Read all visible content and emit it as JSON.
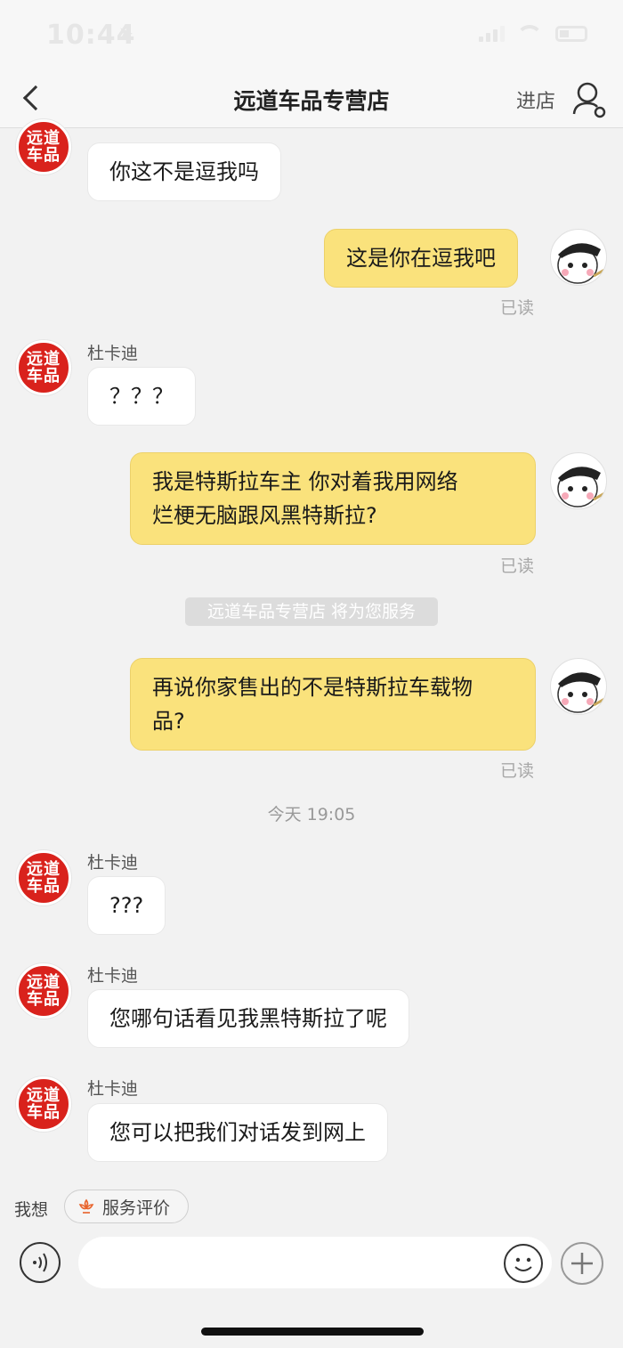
{
  "status_bar": {
    "time": "10:44",
    "location_icon": "location-arrow-icon",
    "signal_icon": "cellular-signal-icon",
    "wifi_icon": "wifi-icon",
    "battery_icon": "battery-icon"
  },
  "nav": {
    "back_icon": "chevron-left-icon",
    "title": "远道车品专营店",
    "enter_store": "进店",
    "user_icon": "user-settings-icon"
  },
  "shop_avatar": {
    "line1": "远道",
    "line2": "车品",
    "color": "#d9221c"
  },
  "messages": [
    {
      "side": "left",
      "sender": "杜卡迪",
      "lines": [
        "你这不是逗我吗"
      ]
    },
    {
      "side": "right",
      "lines": [
        "这是你在逗我吧"
      ],
      "status": "已读"
    },
    {
      "side": "left",
      "sender": "杜卡迪",
      "lines": [
        "？？？"
      ]
    },
    {
      "side": "right",
      "lines": [
        "我是特斯拉车主 你对着我用网络",
        "烂梗无脑跟风黑特斯拉?"
      ],
      "status": "已读"
    },
    {
      "side": "right",
      "lines": [
        "再说你家售出的不是特斯拉车载物",
        "品?"
      ],
      "status": "已读"
    },
    {
      "side": "left",
      "sender": "杜卡迪",
      "lines": [
        "???"
      ]
    },
    {
      "side": "left",
      "sender": "杜卡迪",
      "lines": [
        "您哪句话看见我黑特斯拉了呢"
      ]
    },
    {
      "side": "left",
      "sender": "杜卡迪",
      "lines": [
        "您可以把我们对话发到网上"
      ]
    }
  ],
  "system_note": "远道车品专营店 将为您服务",
  "timestamp": "今天 19:05",
  "quick_bar": {
    "label": "我想",
    "chip": "服务评价",
    "chip_icon": "rating-flower-icon"
  },
  "input_bar": {
    "placeholder": "",
    "voice_icon": "voice-icon",
    "emoji_icon": "emoji-smile-icon",
    "plus_icon": "plus-icon"
  },
  "colors": {
    "bubble_self": "#fae27c",
    "bubble_other": "#ffffff",
    "background": "#f2f2f2"
  }
}
